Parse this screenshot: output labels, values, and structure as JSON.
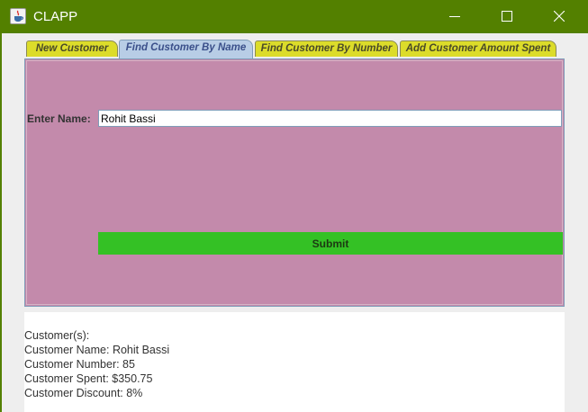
{
  "window": {
    "title": "CLAPP",
    "app_icon": "java-cup-icon",
    "title_bar_color": "#538000"
  },
  "controls": {
    "minimize_icon": "minimize-icon",
    "maximize_icon": "maximize-icon",
    "close_icon": "close-icon"
  },
  "tabs": [
    {
      "label": "New Customer",
      "active": false
    },
    {
      "label": "Find Customer By Name",
      "active": true
    },
    {
      "label": "Find Customer By Number",
      "active": false
    },
    {
      "label": "Add Customer Amount Spent",
      "active": false
    }
  ],
  "find_by_name": {
    "name_label": "Enter Name:",
    "name_value": "Rohit Bassi",
    "submit_label": "Submit",
    "panel_color": "#c38aab",
    "submit_color": "#34c125"
  },
  "results": {
    "heading": "Customer(s):",
    "name_line": "Customer Name: Rohit Bassi",
    "number_line": "Customer Number: 85",
    "spent_line": "Customer Spent: $350.75",
    "discount_line": "Customer Discount: 8%"
  }
}
